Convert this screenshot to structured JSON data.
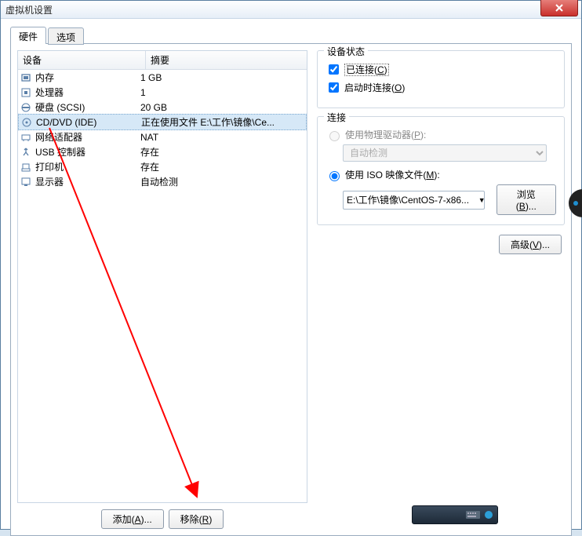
{
  "window": {
    "title": "虚拟机设置"
  },
  "tabs": {
    "hardware": "硬件",
    "options": "选项"
  },
  "hw_list": {
    "head_device": "设备",
    "head_summary": "摘要",
    "items": [
      {
        "name": "内存",
        "summary": "1 GB"
      },
      {
        "name": "处理器",
        "summary": "1"
      },
      {
        "name": "硬盘 (SCSI)",
        "summary": "20 GB"
      },
      {
        "name": "CD/DVD (IDE)",
        "summary": "正在使用文件 E:\\工作\\镜像\\Ce..."
      },
      {
        "name": "网络适配器",
        "summary": "NAT"
      },
      {
        "name": "USB 控制器",
        "summary": "存在"
      },
      {
        "name": "打印机",
        "summary": "存在"
      },
      {
        "name": "显示器",
        "summary": "自动检测"
      }
    ],
    "selected_index": 3
  },
  "buttons": {
    "add": "添加(A)...",
    "remove": "移除(R)",
    "browse": "浏览(B)...",
    "advanced": "高级(V)..."
  },
  "device_status": {
    "group_title": "设备状态",
    "connected": "已连接(C)",
    "connect_at_power": "启动时连接(O)"
  },
  "connection": {
    "group_title": "连接",
    "use_physical": "使用物理驱动器(P):",
    "physical_value": "自动检测",
    "use_iso": "使用 ISO 映像文件(M):",
    "iso_value": "E:\\工作\\镜像\\CentOS-7-x86..."
  }
}
